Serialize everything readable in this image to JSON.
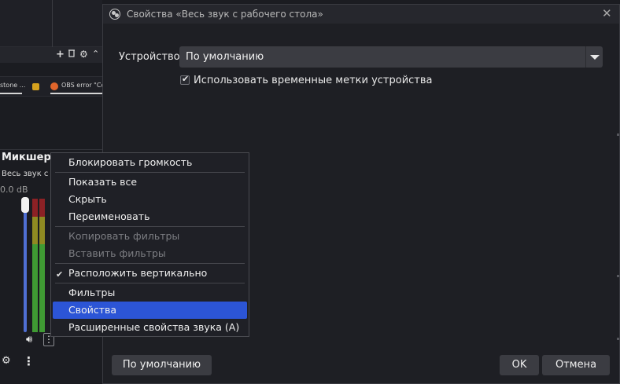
{
  "background": {
    "dock_toolbar_icons": [
      "plus-icon",
      "trash-icon",
      "gear-icon",
      "chevron-up-icon"
    ],
    "tabs": [
      {
        "label": "stone ..."
      },
      {
        "label": "OBS error \"Co"
      }
    ],
    "mixer": {
      "title": "Микшер",
      "source_label": "Весь звук с",
      "db_value": "0.0 dB"
    }
  },
  "dialog": {
    "title": "Свойства «Весь звук с рабочего стола»",
    "device_label": "Устройство",
    "device_value": "По умолчанию",
    "timestamps_checked": true,
    "timestamps_label": "Использовать временные метки устройства",
    "buttons": {
      "defaults": "По умолчанию",
      "ok": "OK",
      "cancel": "Отмена"
    }
  },
  "context_menu": {
    "items": [
      {
        "label": "Блокировать громкость",
        "enabled": true
      },
      {
        "label": "Показать все",
        "enabled": true
      },
      {
        "label": "Скрыть",
        "enabled": true
      },
      {
        "label": "Переименовать",
        "enabled": true
      },
      {
        "label": "Копировать фильтры",
        "enabled": false
      },
      {
        "label": "Вставить фильтры",
        "enabled": false
      },
      {
        "label": "Расположить вертикально",
        "enabled": true,
        "checked": true
      },
      {
        "label": "Фильтры",
        "enabled": true
      },
      {
        "label": "Свойства",
        "enabled": true,
        "highlighted": true
      },
      {
        "label": "Расширенные свойства звука (A)",
        "enabled": true
      }
    ]
  },
  "colors": {
    "accent": "#2c55d6",
    "meter_green": "#3f9a33",
    "meter_yellow": "#8f8a22",
    "meter_red": "#8c2125",
    "volume_blue": "#4f6fd4"
  }
}
